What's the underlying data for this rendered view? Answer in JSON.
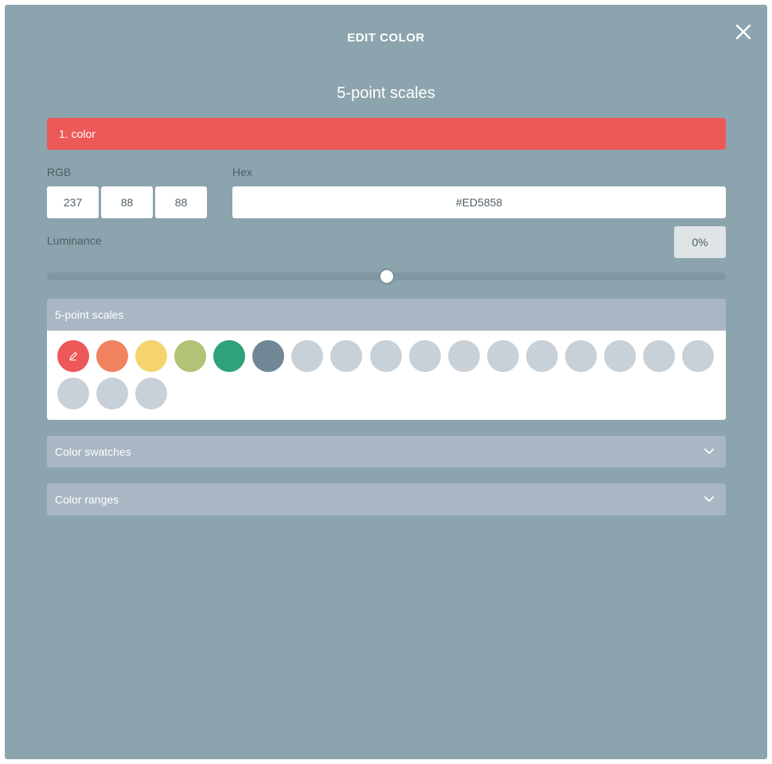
{
  "modal": {
    "title": "EDIT COLOR"
  },
  "scale_title": "5-point scales",
  "selected_color": {
    "label": "1. color",
    "color": "#ED5858"
  },
  "rgb": {
    "label": "RGB",
    "r": "237",
    "g": "88",
    "b": "88"
  },
  "hex": {
    "label": "Hex",
    "value": "#ED5858"
  },
  "luminance": {
    "label": "Luminance",
    "value": "0%",
    "slider_fraction": 0.5
  },
  "palette_panel": {
    "title": "5-point scales",
    "swatches": [
      "#ED5858",
      "#F08260",
      "#F5D46E",
      "#B2C276",
      "#2FA27A",
      "#718795",
      "#C8D0D8",
      "#C8D0D8",
      "#C8D0D8",
      "#C8D0D8",
      "#C8D0D8",
      "#C8D0D8",
      "#C8D0D8",
      "#C8D0D8",
      "#C8D0D8",
      "#C8D0D8",
      "#C8D0D8",
      "#C8D0D8",
      "#C8D0D8",
      "#C8D0D8"
    ],
    "selected_index": 0
  },
  "swatches_panel": {
    "title": "Color swatches"
  },
  "ranges_panel": {
    "title": "Color ranges"
  },
  "icons": {
    "close": "close-icon",
    "edit": "pencil-icon",
    "expand": "chevron-down-icon"
  }
}
